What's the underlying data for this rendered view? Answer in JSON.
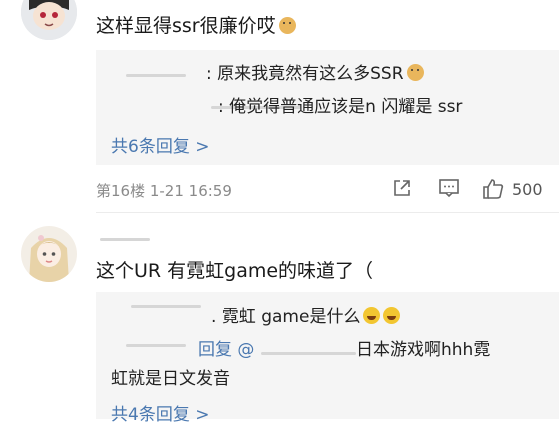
{
  "comments": [
    {
      "text": "这样显得ssr很廉价哎",
      "emoji": "doge-emoji",
      "replies": [
        {
          "text": "原来我竟然有这么多SSR",
          "emoji": "doge-emoji"
        },
        {
          "text": "俺觉得普通应该是n 闪耀是 ssr"
        }
      ],
      "reply_count": "共6条回复 >",
      "meta": "第16楼  1-21 16:59",
      "likes": "500"
    },
    {
      "text": "这个UR 有霓虹game的味道了（",
      "replies": [
        {
          "text": "霓虹 game是什么",
          "emoji": "laugh-cry-emoji"
        },
        {
          "prefix": "回复 @",
          "text": "日本游戏啊hhh霓",
          "cont": "虹就是日文发音"
        }
      ],
      "reply_count": "共4条回复 >"
    }
  ],
  "colors": {
    "link": "#4a78b0",
    "meta": "#8a8a8a",
    "reply_bg": "#f5f5f5"
  },
  "icons": [
    "share-icon",
    "comment-icon",
    "like-icon"
  ]
}
